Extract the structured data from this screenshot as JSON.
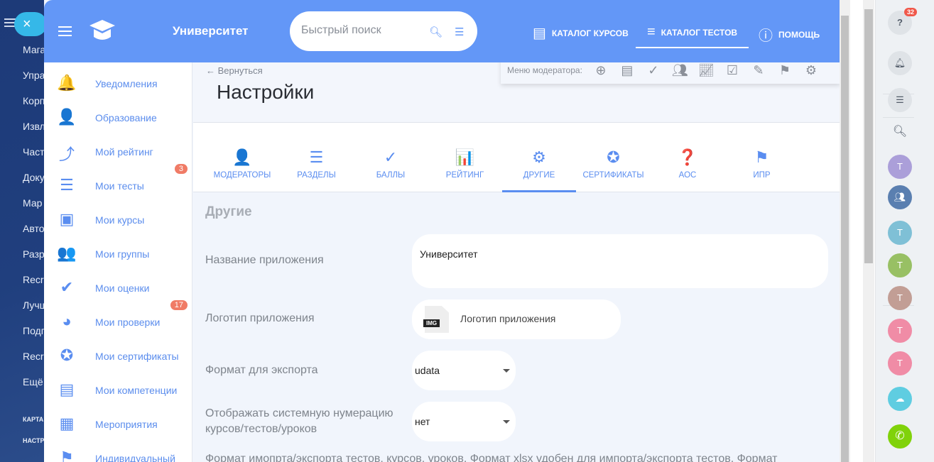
{
  "background_menu": {
    "items": [
      "Мага",
      "Упра",
      "Корп",
      "Извл",
      "Част",
      "Доку",
      "Мар",
      "Авто",
      "Разр",
      "Recr",
      "Лучш",
      "Подп",
      "Recr",
      "Ещё"
    ],
    "small_items": [
      "КАРТА",
      "НАСТР"
    ]
  },
  "header": {
    "brand": "Университет",
    "search_placeholder": "Быстрый поиск",
    "nav": [
      {
        "label": "КАТАЛОГ КУРСОВ",
        "icon": "catalog-icon"
      },
      {
        "label": "КАТАЛОГ ТЕСТОВ",
        "icon": "tests-catalog-icon",
        "active": true
      },
      {
        "label": "ПОМОЩЬ",
        "icon": "help-icon"
      }
    ]
  },
  "sidebar": {
    "items": [
      {
        "label": "Уведомления",
        "icon": "bell-icon",
        "glyph": "🔔"
      },
      {
        "label": "Образование",
        "icon": "person-icon",
        "glyph": "👤"
      },
      {
        "label": "Мой рейтинг",
        "icon": "rating-icon",
        "glyph": "⤴"
      },
      {
        "label": "Мои тесты",
        "icon": "tests-icon",
        "glyph": "☰",
        "badge": "3"
      },
      {
        "label": "Мои курсы",
        "icon": "courses-icon",
        "glyph": "▣"
      },
      {
        "label": "Мои группы",
        "icon": "groups-icon",
        "glyph": "👥"
      },
      {
        "label": "Мои оценки",
        "icon": "check-circle-icon",
        "glyph": "✔"
      },
      {
        "label": "Мои проверки",
        "icon": "review-icon",
        "glyph": "◕",
        "badge": "17"
      },
      {
        "label": "Мои сертификаты",
        "icon": "certificate-icon",
        "glyph": "✪"
      },
      {
        "label": "Мои компетенции",
        "icon": "badge-icon",
        "glyph": "▤"
      },
      {
        "label": "Мероприятия",
        "icon": "calendar-icon",
        "glyph": "▦"
      },
      {
        "label": "Индивидуальный",
        "icon": "ipr-icon",
        "glyph": "⚑"
      }
    ]
  },
  "page": {
    "back": "← Вернуться",
    "title": "Настройки",
    "moderator_menu_label": "Меню модератора:",
    "moderator_icons": [
      "add-list-icon",
      "notes-icon",
      "check-add-icon",
      "users-icon",
      "chart-icon",
      "checklist-icon",
      "edit-icon",
      "person-board-icon",
      "gear-icon"
    ],
    "tabs": [
      {
        "label": "МОДЕРАТОРЫ",
        "glyph": "👤"
      },
      {
        "label": "РАЗДЕЛЫ",
        "glyph": "☰"
      },
      {
        "label": "БАЛЛЫ",
        "glyph": "✓"
      },
      {
        "label": "РЕЙТИНГ",
        "glyph": "📊"
      },
      {
        "label": "ДРУГИЕ",
        "glyph": "⚙",
        "active": true
      },
      {
        "label": "СЕРТИФИКАТЫ",
        "glyph": "✪"
      },
      {
        "label": "АОС",
        "glyph": "❓"
      },
      {
        "label": "ИПР",
        "glyph": "⚑"
      }
    ],
    "section": "Другие",
    "fields": {
      "app_name_label": "Название приложения",
      "app_name_value": "Университет",
      "logo_label": "Логотип приложения",
      "logo_button": "Логотип приложения",
      "logo_file_tag": "IMG",
      "export_label": "Формат для экспорта",
      "export_value": "udata",
      "numbering_label": "Отображать системную нумерацию курсов/тестов/уроков",
      "numbering_value": "нет"
    },
    "note": "Формат имопрта/экспорта тестов, курсов, уроков. Формат xlsx удобен для импорта/экспорта тестов. Формат"
  },
  "right_panel": {
    "help_badge": "32",
    "avatars": [
      {
        "letter": "Т",
        "color": "#ab9fd9"
      },
      {
        "letter": "Т",
        "color": "#7fc0d6"
      },
      {
        "letter": "Т",
        "color": "#98c064"
      },
      {
        "letter": "Т",
        "color": "#c29e95"
      },
      {
        "letter": "Т",
        "color": "#f08ca6"
      },
      {
        "letter": "Т",
        "color": "#f08ca6"
      }
    ]
  }
}
